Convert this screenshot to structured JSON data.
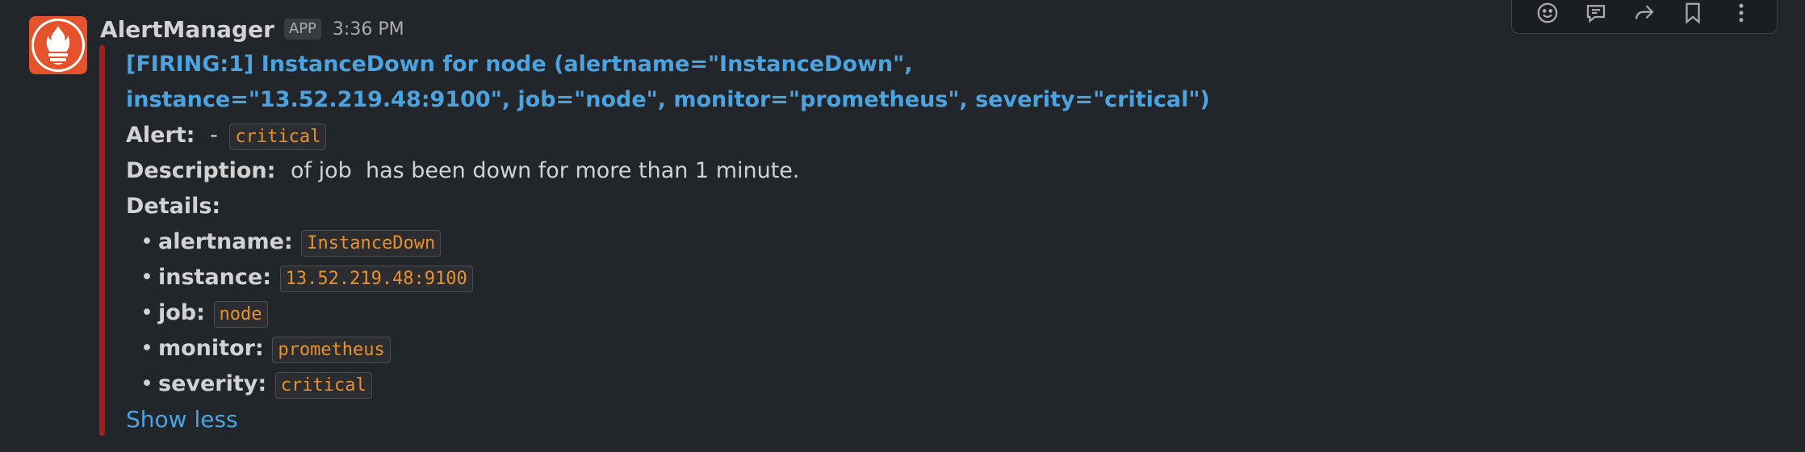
{
  "message": {
    "sender": "AlertManager",
    "badge": "APP",
    "time": "3:36 PM",
    "title_line1": "[FIRING:1] InstanceDown for node (alertname=\"InstanceDown\",",
    "title_line2": "instance=\"13.52.219.48:9100\", job=\"node\", monitor=\"prometheus\", severity=\"critical\")",
    "alert_label": "Alert:",
    "alert_sep": "-",
    "alert_value": "critical",
    "description_label": "Description:",
    "description_text": "of job  has been down for more than 1 minute.",
    "details_label": "Details:",
    "details": [
      {
        "key": "alertname:",
        "value": "InstanceDown"
      },
      {
        "key": "instance:",
        "value": "13.52.219.48:9100"
      },
      {
        "key": "job:",
        "value": "node"
      },
      {
        "key": "monitor:",
        "value": "prometheus"
      },
      {
        "key": "severity:",
        "value": "critical"
      }
    ],
    "bullet": "•",
    "show_less": "Show less",
    "attachment_color": "#a3201e"
  },
  "actions": [
    {
      "icon": "emoji-reaction-icon"
    },
    {
      "icon": "reply-thread-icon"
    },
    {
      "icon": "share-icon"
    },
    {
      "icon": "bookmark-icon"
    },
    {
      "icon": "more-actions-icon"
    }
  ],
  "avatar": {
    "icon": "prometheus-logo",
    "color": "#e6522c"
  }
}
